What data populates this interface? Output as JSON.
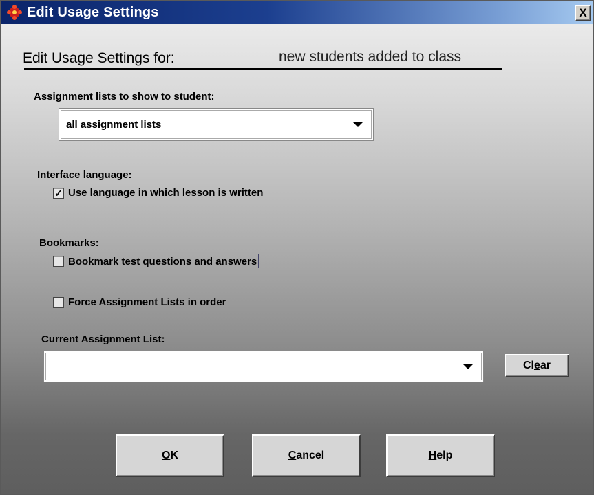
{
  "window": {
    "title": "Edit Usage Settings",
    "close_glyph": "X"
  },
  "header": {
    "label": "Edit Usage Settings for:",
    "target": "new students added to class"
  },
  "assignment_lists": {
    "label": "Assignment lists to show to student:",
    "selected": "all assignment lists"
  },
  "interface_language": {
    "label": "Interface language:",
    "option_label": "Use language in which lesson is written",
    "checked": true
  },
  "bookmarks": {
    "label": "Bookmarks:",
    "option_label": "Bookmark test questions and answers",
    "checked": false
  },
  "force_order": {
    "label": "Force Assignment Lists in order",
    "checked": false
  },
  "current_list": {
    "label": "Current Assignment List:",
    "selected": ""
  },
  "buttons": {
    "clear": {
      "mnemonic": "e",
      "pre": "Cl",
      "post": "ar"
    },
    "ok": {
      "mnemonic": "O",
      "pre": "",
      "post": "K"
    },
    "cancel": {
      "mnemonic": "C",
      "pre": "",
      "post": "ancel"
    },
    "help": {
      "mnemonic": "H",
      "pre": "",
      "post": "elp"
    }
  },
  "colors": {
    "titlebar_start": "#0a246a",
    "titlebar_end": "#a6caf0"
  }
}
